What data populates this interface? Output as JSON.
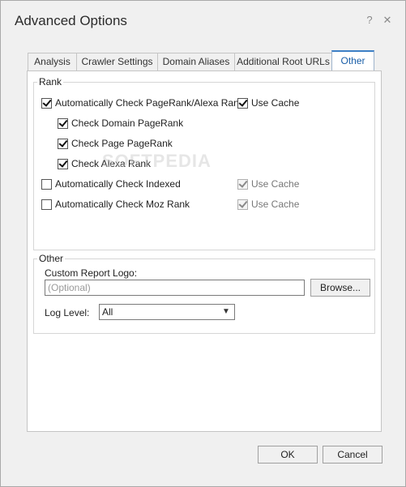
{
  "window": {
    "title": "Advanced Options",
    "help_glyph": "?",
    "close_glyph": "✕"
  },
  "tabs": [
    {
      "label": "Analysis",
      "active": false
    },
    {
      "label": "Crawler Settings",
      "active": false
    },
    {
      "label": "Domain Aliases",
      "active": false
    },
    {
      "label": "Additional Root URLs",
      "active": false
    },
    {
      "label": "Other",
      "active": true
    }
  ],
  "rank": {
    "group_label": "Rank",
    "auto_pagerank_alexa": {
      "label": "Automatically Check PageRank/Alexa Rank",
      "checked": true
    },
    "use_cache_1": {
      "label": "Use Cache",
      "checked": true,
      "disabled": false
    },
    "domain_pagerank": {
      "label": "Check Domain PageRank",
      "checked": true
    },
    "page_pagerank": {
      "label": "Check Page PageRank",
      "checked": true
    },
    "alexa_rank": {
      "label": "Check Alexa Rank",
      "checked": true
    },
    "auto_indexed": {
      "label": "Automatically Check Indexed",
      "checked": false
    },
    "use_cache_2": {
      "label": "Use Cache",
      "checked": true,
      "disabled": true
    },
    "auto_moz": {
      "label": "Automatically Check Moz Rank",
      "checked": false
    },
    "use_cache_3": {
      "label": "Use Cache",
      "checked": true,
      "disabled": true
    }
  },
  "other": {
    "group_label": "Other",
    "logo_label": "Custom Report Logo:",
    "logo_value": "",
    "logo_placeholder": "(Optional)",
    "browse_label": "Browse...",
    "log_level_label": "Log Level:",
    "log_level_value": "All"
  },
  "footer": {
    "ok_label": "OK",
    "cancel_label": "Cancel"
  },
  "watermark": "SOFTPEDIA"
}
